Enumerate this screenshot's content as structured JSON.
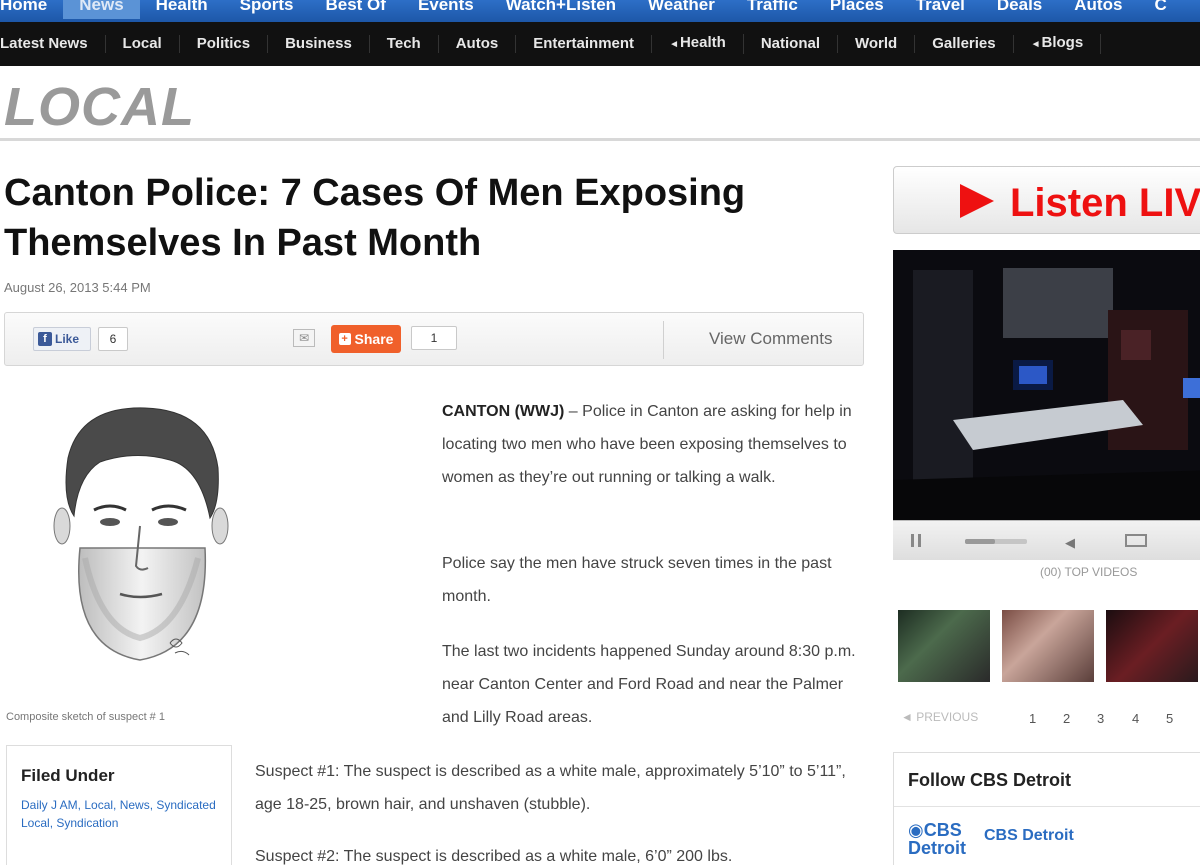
{
  "nav": {
    "top": [
      "Home",
      "News",
      "Health",
      "Sports",
      "Best Of",
      "Events",
      "Watch+Listen",
      "Weather",
      "Traffic",
      "Places",
      "Travel",
      "Deals",
      "Autos",
      "C"
    ],
    "sub": [
      "Latest News",
      "Local",
      "Politics",
      "Business",
      "Tech",
      "Autos",
      "Entertainment",
      "Health",
      "National",
      "World",
      "Galleries",
      "Blogs"
    ]
  },
  "section": {
    "title": "LOCAL"
  },
  "article": {
    "headline": "Canton Police: 7 Cases Of Men Exposing Themselves In Past Month",
    "date": "August 26, 2013 5:44 PM",
    "share": {
      "like_label": "Like",
      "like_count": "6",
      "share_label": "Share",
      "share_count": "1",
      "comments_label": "View Comments"
    },
    "caption": "Composite sketch of suspect # 1",
    "lead_dateline": "CANTON (WWJ)",
    "p1": " – Police in Canton are asking for help in locating two men who have been exposing themselves to women as they’re out running or talking a walk.",
    "p2": "Police say the men have struck seven times in the past month.",
    "p3": "The last two incidents happened Sunday around 8:30 p.m. near Canton Center and Ford Road and near the Palmer and Lilly Road areas.",
    "p4": "Suspect #1: The suspect is described as a white male, approximately 5’10” to 5’11”, age 18-25, brown hair, and unshaven (stubble).",
    "p5": "Suspect #2: The suspect is described as a white male, 6’0” 200 lbs."
  },
  "filed_under": {
    "title": "Filed Under",
    "links": "Daily J AM, Local, News, Syndicated Local, Syndication"
  },
  "sidebar": {
    "listen_label": "Listen LIV",
    "top_videos": "(00) TOP VIDEOS",
    "pager": {
      "prev": "◄ PREVIOUS",
      "pages": [
        "1",
        "2",
        "3",
        "4",
        "5"
      ]
    },
    "follow_title": "Follow CBS Detroit",
    "logo_top": "CBS",
    "logo_bottom": "Detroit",
    "follow_name": "CBS Detroit"
  }
}
